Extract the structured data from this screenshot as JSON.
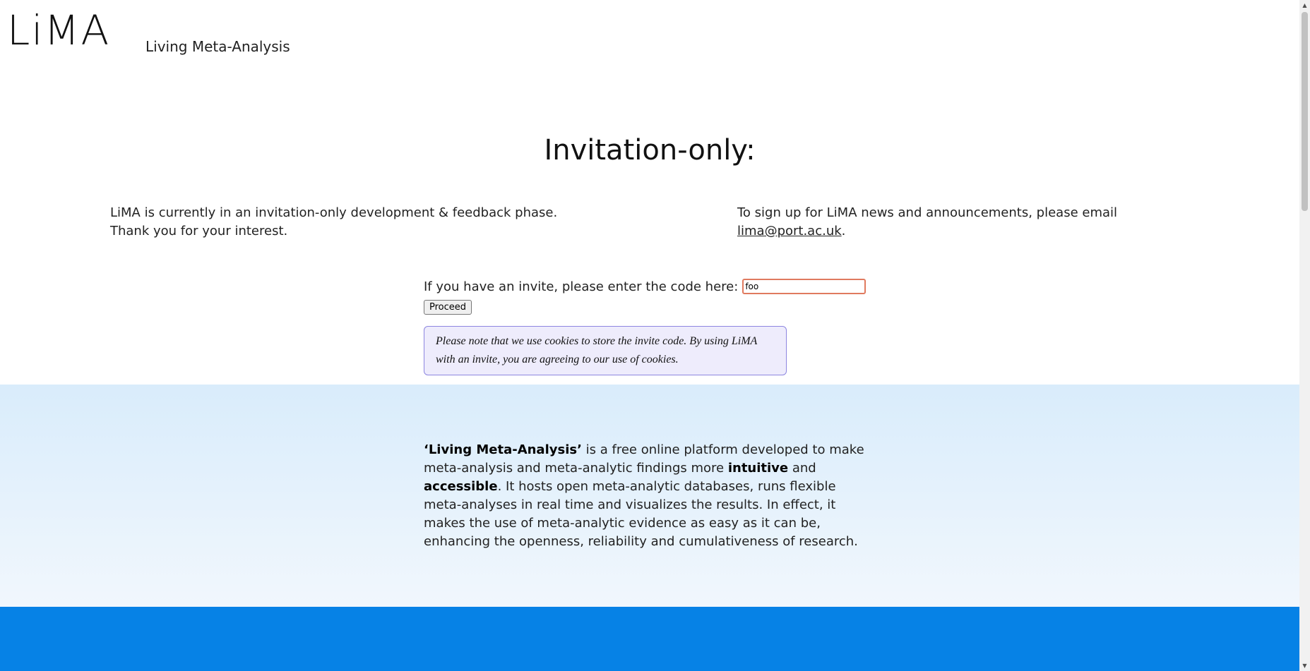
{
  "header": {
    "logo": "LiMA",
    "tagline": "Living Meta-Analysis"
  },
  "main": {
    "title": "Invitation-only:",
    "left_line1": "LiMA is currently in an invitation-only development & feedback phase.",
    "left_line2": "Thank you for your interest.",
    "right_line1": "To sign up for LiMA news and announcements, please email",
    "right_email": "lima@port.ac.uk",
    "right_end": ".",
    "invite_prompt": "If you have an invite, please enter the code here:",
    "invite_value": "foo",
    "proceed_label": "Proceed",
    "cookie_note": "Please note that we use cookies to store the invite code. By using LiMA with an invite, you are agreeing to our use of cookies."
  },
  "about": {
    "p_name": "‘Living Meta-Analysis’",
    "p_part1": " is a free online platform developed to make meta-analysis and meta-analytic findings more ",
    "p_bold1": "intuitive",
    "p_part2": " and ",
    "p_bold2": "accessible",
    "p_part3": ". It hosts open meta-analytic databases, runs flexible meta-analyses in real time and visualizes the results. In effect, it makes the use of meta-analytic evidence as easy as it can be, enhancing the openness, reliability and cumulativeness of research."
  },
  "colors": {
    "accent_blue": "#0682e6",
    "cookie_bg": "#eeecfc",
    "cookie_border": "#8d86e0",
    "input_border": "#e07a5f"
  },
  "icons": {
    "scroll_up": "scroll-up-arrow-icon",
    "scroll_down": "scroll-down-arrow-icon"
  }
}
